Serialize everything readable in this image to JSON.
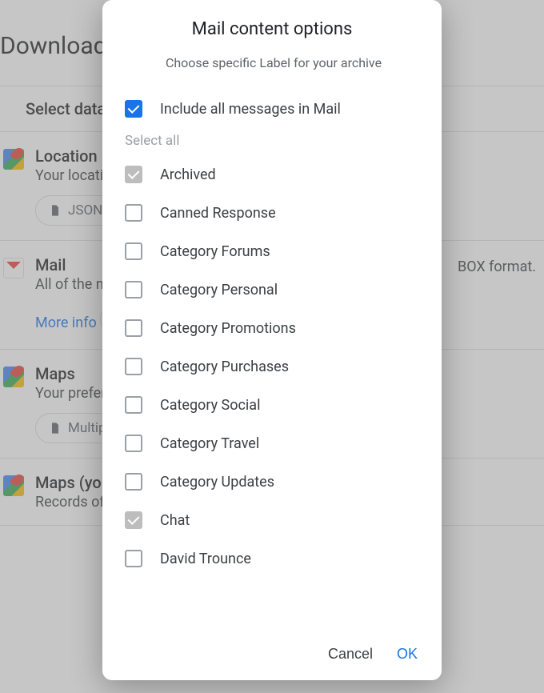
{
  "background": {
    "header": "Download yo",
    "select_data_header": "Select data",
    "mbox_right_text": "BOX format.",
    "products": [
      {
        "title": "Location His",
        "sub": "Your location",
        "chip": "JSON format",
        "chip_type": "file"
      },
      {
        "title": "Mail",
        "sub": "All of the me",
        "link": "More info",
        "chip": "MBOX forma",
        "chip_type": "file-blue"
      },
      {
        "title": "Maps",
        "sub": "Your preferen",
        "chip": "Multiple form",
        "chip_type": "file"
      },
      {
        "title": "Maps (your p",
        "sub": "Records of y"
      }
    ]
  },
  "dialog": {
    "title": "Mail content options",
    "subtitle": "Choose specific Label for your archive",
    "include_all": "Include all messages in Mail",
    "select_all": "Select all",
    "labels": [
      {
        "name": "Archived",
        "state": "checked-disabled"
      },
      {
        "name": "Canned Response",
        "state": ""
      },
      {
        "name": "Category Forums",
        "state": ""
      },
      {
        "name": "Category Personal",
        "state": ""
      },
      {
        "name": "Category Promotions",
        "state": ""
      },
      {
        "name": "Category Purchases",
        "state": ""
      },
      {
        "name": "Category Social",
        "state": ""
      },
      {
        "name": "Category Travel",
        "state": ""
      },
      {
        "name": "Category Updates",
        "state": ""
      },
      {
        "name": "Chat",
        "state": "checked-disabled"
      },
      {
        "name": "David Trounce",
        "state": ""
      }
    ],
    "cancel": "Cancel",
    "ok": "OK"
  }
}
